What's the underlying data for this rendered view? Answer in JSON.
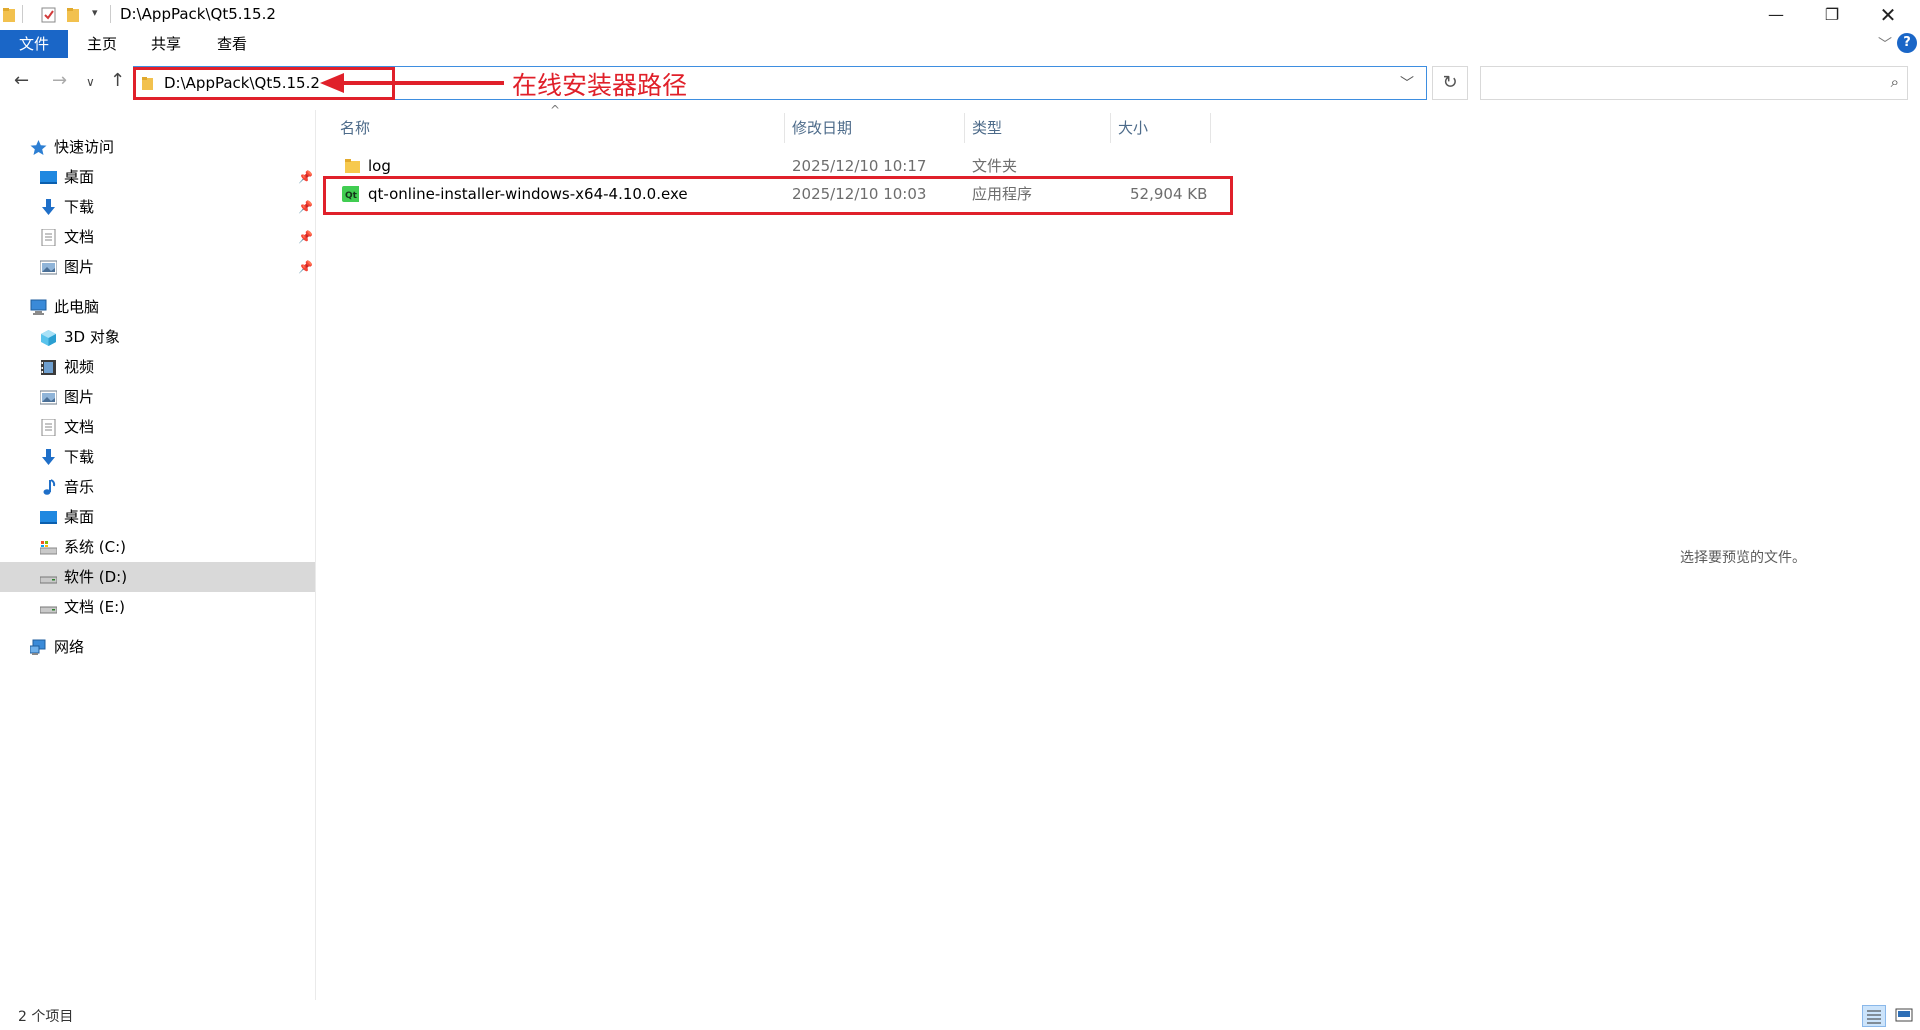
{
  "window": {
    "title": "D:\\AppPack\\Qt5.15.2",
    "minimize_icon": "minimize-icon",
    "restore_icon": "restore-icon",
    "close_icon": "close-icon"
  },
  "ribbon": {
    "tabs": [
      {
        "label": "文件",
        "active": true
      },
      {
        "label": "主页"
      },
      {
        "label": "共享"
      },
      {
        "label": "查看"
      }
    ],
    "help_label": "?"
  },
  "nav": {
    "address": "D:\\AppPack\\Qt5.15.2",
    "search_placeholder": ""
  },
  "annotation": {
    "text": "在线安装器路径",
    "color": "#e0202a"
  },
  "sidebar": {
    "quick_access": {
      "label": "快速访问",
      "items": [
        {
          "label": "桌面",
          "icon": "desktop-icon",
          "pinned": true
        },
        {
          "label": "下载",
          "icon": "download-icon",
          "pinned": true
        },
        {
          "label": "文档",
          "icon": "document-icon",
          "pinned": true
        },
        {
          "label": "图片",
          "icon": "pictures-icon",
          "pinned": true
        }
      ]
    },
    "this_pc": {
      "label": "此电脑",
      "items": [
        {
          "label": "3D 对象",
          "icon": "3d-objects-icon"
        },
        {
          "label": "视频",
          "icon": "video-icon"
        },
        {
          "label": "图片",
          "icon": "pictures-icon"
        },
        {
          "label": "文档",
          "icon": "document-icon"
        },
        {
          "label": "下载",
          "icon": "download-icon"
        },
        {
          "label": "音乐",
          "icon": "music-icon"
        },
        {
          "label": "桌面",
          "icon": "desktop-icon"
        },
        {
          "label": "系统 (C:)",
          "icon": "system-drive-icon"
        },
        {
          "label": "软件 (D:)",
          "icon": "drive-icon",
          "selected": true
        },
        {
          "label": "文档 (E:)",
          "icon": "drive-icon"
        }
      ]
    },
    "network": {
      "label": "网络",
      "icon": "network-icon"
    }
  },
  "columns": {
    "name": "名称",
    "modified": "修改日期",
    "type": "类型",
    "size": "大小"
  },
  "files": [
    {
      "name": "log",
      "modified": "2025/12/10 10:17",
      "type": "文件夹",
      "size": "",
      "icon": "folder-icon"
    },
    {
      "name": "qt-online-installer-windows-x64-4.10.0.exe",
      "modified": "2025/12/10 10:03",
      "type": "应用程序",
      "size": "52,904 KB",
      "icon": "qt-app-icon",
      "highlighted": true
    }
  ],
  "preview_pane": {
    "message": "选择要预览的文件。"
  },
  "status": {
    "item_count": "2 个项目"
  },
  "colors": {
    "accent": "#1a66c7",
    "selection": "#d9d9d9",
    "annotation": "#e0202a"
  }
}
